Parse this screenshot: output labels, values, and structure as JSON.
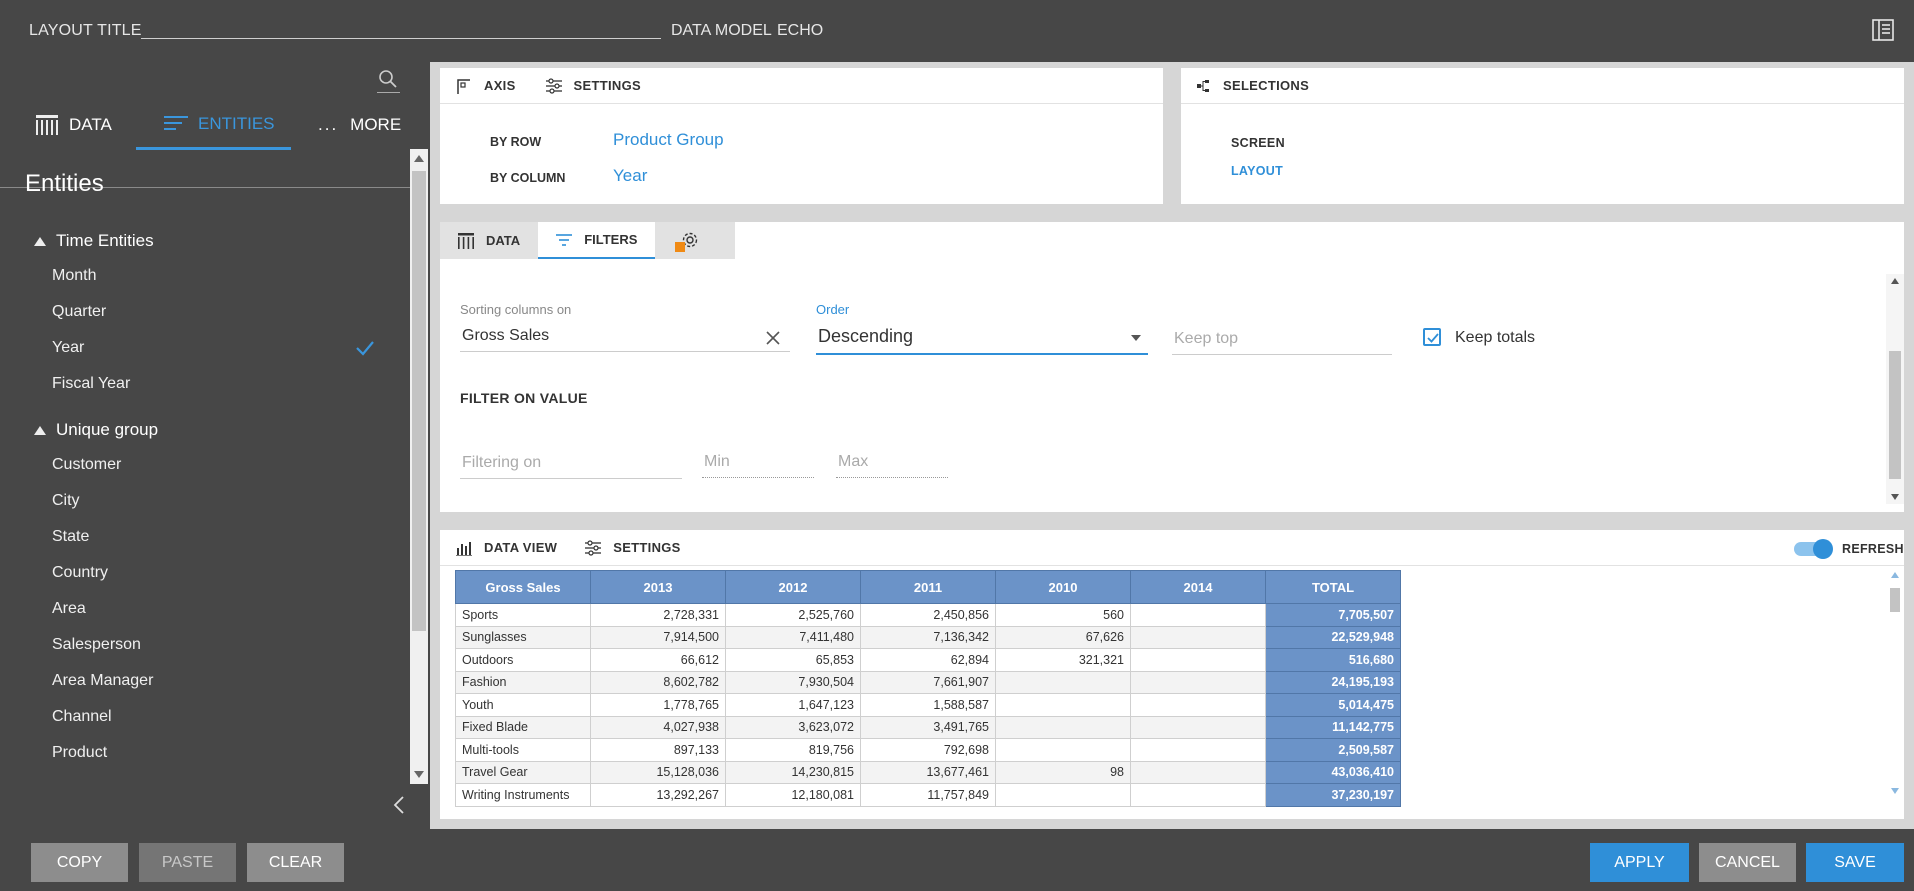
{
  "topbar": {
    "layout_title_label": "LAYOUT TITLE",
    "data_model_label": "DATA MODEL",
    "data_model_value": "ECHO"
  },
  "left": {
    "tabs": {
      "data": "DATA",
      "entities": "ENTITIES",
      "more": "MORE"
    },
    "title": "Entities",
    "groups": [
      {
        "name": "Time Entities",
        "items": [
          "Month",
          "Quarter",
          "Year",
          "Fiscal Year"
        ],
        "checked": "Year"
      },
      {
        "name": "Unique group",
        "items": [
          "Customer",
          "City",
          "State",
          "Country",
          "Area",
          "Salesperson",
          "Area Manager",
          "Channel",
          "Product"
        ]
      }
    ]
  },
  "bottom": {
    "copy": "COPY",
    "paste": "PASTE",
    "clear": "CLEAR",
    "apply": "APPLY",
    "cancel": "CANCEL",
    "save": "SAVE"
  },
  "axis_card": {
    "tabs": {
      "axis": "AXIS",
      "settings": "SETTINGS"
    },
    "by_row_label": "BY ROW",
    "by_row_value": "Product Group",
    "by_column_label": "BY COLUMN",
    "by_column_value": "Year"
  },
  "selections_card": {
    "title": "SELECTIONS",
    "screen": "SCREEN",
    "layout": "LAYOUT"
  },
  "filters_card": {
    "tabs": {
      "data": "DATA",
      "filters": "FILTERS"
    },
    "sorting_label": "Sorting columns on",
    "sorting_value": "Gross Sales",
    "order_label": "Order",
    "order_value": "Descending",
    "keep_top_placeholder": "Keep top",
    "keep_totals_label": "Keep totals",
    "keep_totals_checked": true,
    "filter_on_value_title": "FILTER ON VALUE",
    "filtering_on_placeholder": "Filtering on",
    "min_placeholder": "Min",
    "max_placeholder": "Max"
  },
  "data_view": {
    "tabs": {
      "data_view": "DATA VIEW",
      "settings": "SETTINGS"
    },
    "refresh_label": "REFRESH",
    "refresh_on": true,
    "columns": [
      "Gross Sales",
      "2013",
      "2012",
      "2011",
      "2010",
      "2014",
      "TOTAL"
    ],
    "rows": [
      [
        "Sports",
        "2,728,331",
        "2,525,760",
        "2,450,856",
        "560",
        "",
        "7,705,507"
      ],
      [
        "Sunglasses",
        "7,914,500",
        "7,411,480",
        "7,136,342",
        "67,626",
        "",
        "22,529,948"
      ],
      [
        "Outdoors",
        "66,612",
        "65,853",
        "62,894",
        "321,321",
        "",
        "516,680"
      ],
      [
        "Fashion",
        "8,602,782",
        "7,930,504",
        "7,661,907",
        "",
        "",
        "24,195,193"
      ],
      [
        "Youth",
        "1,778,765",
        "1,647,123",
        "1,588,587",
        "",
        "",
        "5,014,475"
      ],
      [
        "Fixed Blade",
        "4,027,938",
        "3,623,072",
        "3,491,765",
        "",
        "",
        "11,142,775"
      ],
      [
        "Multi-tools",
        "897,133",
        "819,756",
        "792,698",
        "",
        "",
        "2,509,587"
      ],
      [
        "Travel Gear",
        "15,128,036",
        "14,230,815",
        "13,677,461",
        "98",
        "",
        "43,036,410"
      ],
      [
        "Writing Instruments",
        "13,292,267",
        "12,180,081",
        "11,757,849",
        "",
        "",
        "37,230,197"
      ]
    ]
  }
}
